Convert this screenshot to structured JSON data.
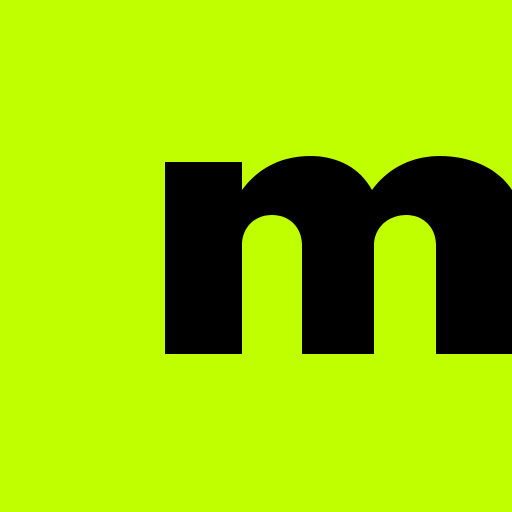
{
  "logo": {
    "letter": "m",
    "icon": "brand-letter-m-logo"
  },
  "colors": {
    "background": "#BFFF00",
    "glyph": "#000000"
  }
}
